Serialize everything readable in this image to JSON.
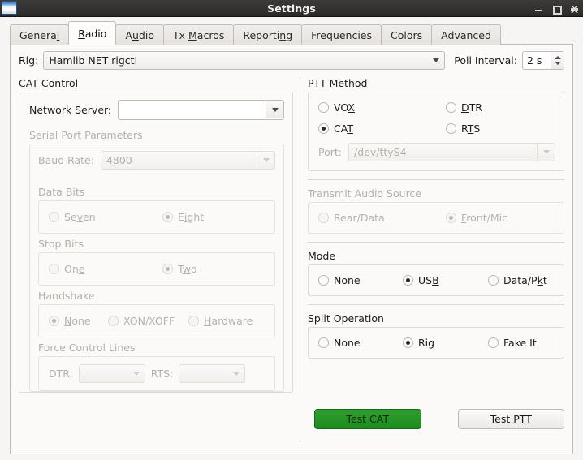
{
  "window": {
    "title": "Settings",
    "icon": "app-icon",
    "buttons": {
      "minimize": "minimize-icon",
      "maximize": "maximize-icon",
      "close": "close-icon"
    }
  },
  "tabs": [
    {
      "label": "General",
      "mnemonic_index": 6,
      "active": false
    },
    {
      "label": "Radio",
      "mnemonic_index": 0,
      "active": true
    },
    {
      "label": "Audio",
      "mnemonic_index": 1,
      "active": false
    },
    {
      "label": "Tx Macros",
      "mnemonic_index": 3,
      "active": false
    },
    {
      "label": "Reporting",
      "mnemonic_index": 7,
      "active": false
    },
    {
      "label": "Frequencies",
      "mnemonic_index": -1,
      "active": false
    },
    {
      "label": "Colors",
      "mnemonic_index": -1,
      "active": false
    },
    {
      "label": "Advanced",
      "mnemonic_index": -1,
      "active": false
    }
  ],
  "rig_row": {
    "label": "Rig:",
    "value": "Hamlib NET rigctl",
    "poll_label": "Poll Interval:",
    "poll_value": "2 s"
  },
  "cat_control": {
    "title": "CAT Control",
    "network_server": {
      "label": "Network Server:",
      "value": "",
      "placeholder": ""
    },
    "serial_port_parameters": {
      "title": "Serial Port Parameters",
      "enabled": false,
      "baud_rate": {
        "label": "Baud Rate:",
        "value": "4800"
      },
      "data_bits": {
        "title": "Data Bits",
        "options": [
          {
            "label": "Seven",
            "mnemonic_index": 3,
            "selected": false
          },
          {
            "label": "Eight",
            "mnemonic_index": 1,
            "selected": true
          }
        ]
      },
      "stop_bits": {
        "title": "Stop Bits",
        "options": [
          {
            "label": "One",
            "mnemonic_index": 2,
            "selected": false
          },
          {
            "label": "Two",
            "mnemonic_index": 1,
            "selected": true
          }
        ]
      },
      "handshake": {
        "title": "Handshake",
        "options": [
          {
            "label": "None",
            "mnemonic_index": 0,
            "selected": true
          },
          {
            "label": "XON/XOFF",
            "mnemonic_index": -1,
            "selected": false
          },
          {
            "label": "Hardware",
            "mnemonic_index": 0,
            "selected": false
          }
        ]
      },
      "force_control_lines": {
        "title": "Force Control Lines",
        "dtr_label": "DTR:",
        "dtr_value": "",
        "rts_label": "RTS:",
        "rts_value": ""
      }
    }
  },
  "ptt_method": {
    "title": "PTT Method",
    "options": [
      {
        "label": "VOX",
        "mnemonic_index": 2,
        "selected": false
      },
      {
        "label": "DTR",
        "mnemonic_index": 0,
        "selected": false
      },
      {
        "label": "CAT",
        "mnemonic_index": 2,
        "selected": true
      },
      {
        "label": "RTS",
        "mnemonic_index": 1,
        "selected": false
      }
    ],
    "port": {
      "label": "Port:",
      "value": "/dev/ttyS4",
      "enabled": false
    }
  },
  "transmit_audio_source": {
    "title": "Transmit Audio Source",
    "enabled": false,
    "options": [
      {
        "label": "Rear/Data",
        "mnemonic_index": -1,
        "selected": false
      },
      {
        "label": "Front/Mic",
        "mnemonic_index": 0,
        "selected": true
      }
    ]
  },
  "mode": {
    "title": "Mode",
    "options": [
      {
        "label": "None",
        "mnemonic_index": -1,
        "selected": false
      },
      {
        "label": "USB",
        "mnemonic_index": 2,
        "selected": true
      },
      {
        "label": "Data/Pkt",
        "mnemonic_index": 6,
        "selected": false
      }
    ]
  },
  "split_operation": {
    "title": "Split Operation",
    "options": [
      {
        "label": "None",
        "mnemonic_index": -1,
        "selected": false
      },
      {
        "label": "Rig",
        "mnemonic_index": -1,
        "selected": true
      },
      {
        "label": "Fake It",
        "mnemonic_index": -1,
        "selected": false
      }
    ]
  },
  "actions": {
    "test_cat": "Test CAT",
    "test_ptt": "Test PTT",
    "test_cat_color": "#1e8b1e"
  }
}
